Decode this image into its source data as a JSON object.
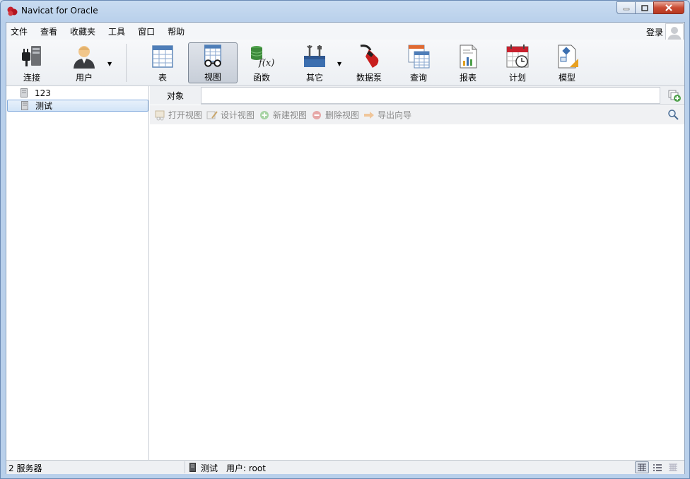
{
  "window": {
    "title": "Navicat for Oracle"
  },
  "menu": {
    "items": [
      "文件",
      "查看",
      "收藏夹",
      "工具",
      "窗口",
      "帮助"
    ],
    "login": "登录"
  },
  "toolbar": {
    "connect": "连接",
    "user": "用户",
    "table": "表",
    "view": "视图",
    "function": "函数",
    "other": "其它",
    "datapump": "数据泵",
    "query": "查询",
    "report": "报表",
    "schedule": "计划",
    "model": "模型"
  },
  "connections": [
    {
      "label": "123",
      "selected": false
    },
    {
      "label": "测试",
      "selected": true
    }
  ],
  "objects": {
    "tab_label": "对象",
    "actions": [
      "打开视图",
      "设计视图",
      "新建视图",
      "删除视图",
      "导出向导"
    ]
  },
  "status": {
    "server_count": "2 服务器",
    "connection": "测试",
    "user": "用户: root"
  }
}
